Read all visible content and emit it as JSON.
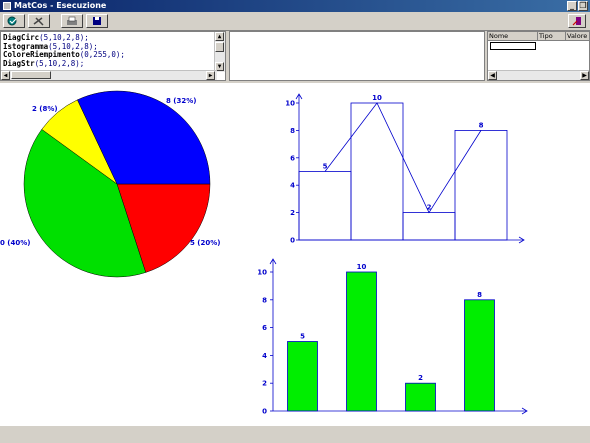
{
  "window": {
    "title": "MatCos - Esecuzione",
    "min_label": "_",
    "max_label": "❐"
  },
  "toolbar": {
    "buttons": [
      "run",
      "stop",
      "print",
      "save"
    ]
  },
  "code": {
    "lines": [
      {
        "fn": "DiagCirc",
        "args": "(5,10,2,8);"
      },
      {
        "fn": "Istogramma",
        "args": "(5,10,2,8);"
      },
      {
        "fn": "ColoreRiempimento",
        "args": "(0,255,0);"
      },
      {
        "fn": "DiagStr",
        "args": "(5,10,2,8);"
      }
    ]
  },
  "variables": {
    "columns": [
      "Nome",
      "Tipo",
      "Valore"
    ]
  },
  "chart_data": [
    {
      "type": "pie",
      "values": [
        5,
        10,
        2,
        8
      ],
      "colors": [
        "#ff0000",
        "#00e000",
        "#ffff00",
        "#0000ff"
      ],
      "labels": [
        "5 (20%)",
        "0 (40%)",
        "2 (8%)",
        "8 (32%)"
      ]
    },
    {
      "type": "bar",
      "style": "outline-with-line",
      "values": [
        5,
        10,
        2,
        8
      ],
      "value_labels": [
        "5",
        "10",
        "2",
        "8"
      ],
      "y_ticks": [
        "0",
        "2",
        "4",
        "6",
        "8",
        "10"
      ],
      "ylim": [
        0,
        10
      ],
      "color": "#0000cc"
    },
    {
      "type": "bar",
      "style": "filled",
      "values": [
        5,
        10,
        2,
        8
      ],
      "value_labels": [
        "5",
        "10",
        "2",
        "8"
      ],
      "y_ticks": [
        "0",
        "2",
        "4",
        "6",
        "8",
        "10"
      ],
      "ylim": [
        0,
        10
      ],
      "fill": "#00ee00",
      "color": "#0000cc"
    }
  ]
}
